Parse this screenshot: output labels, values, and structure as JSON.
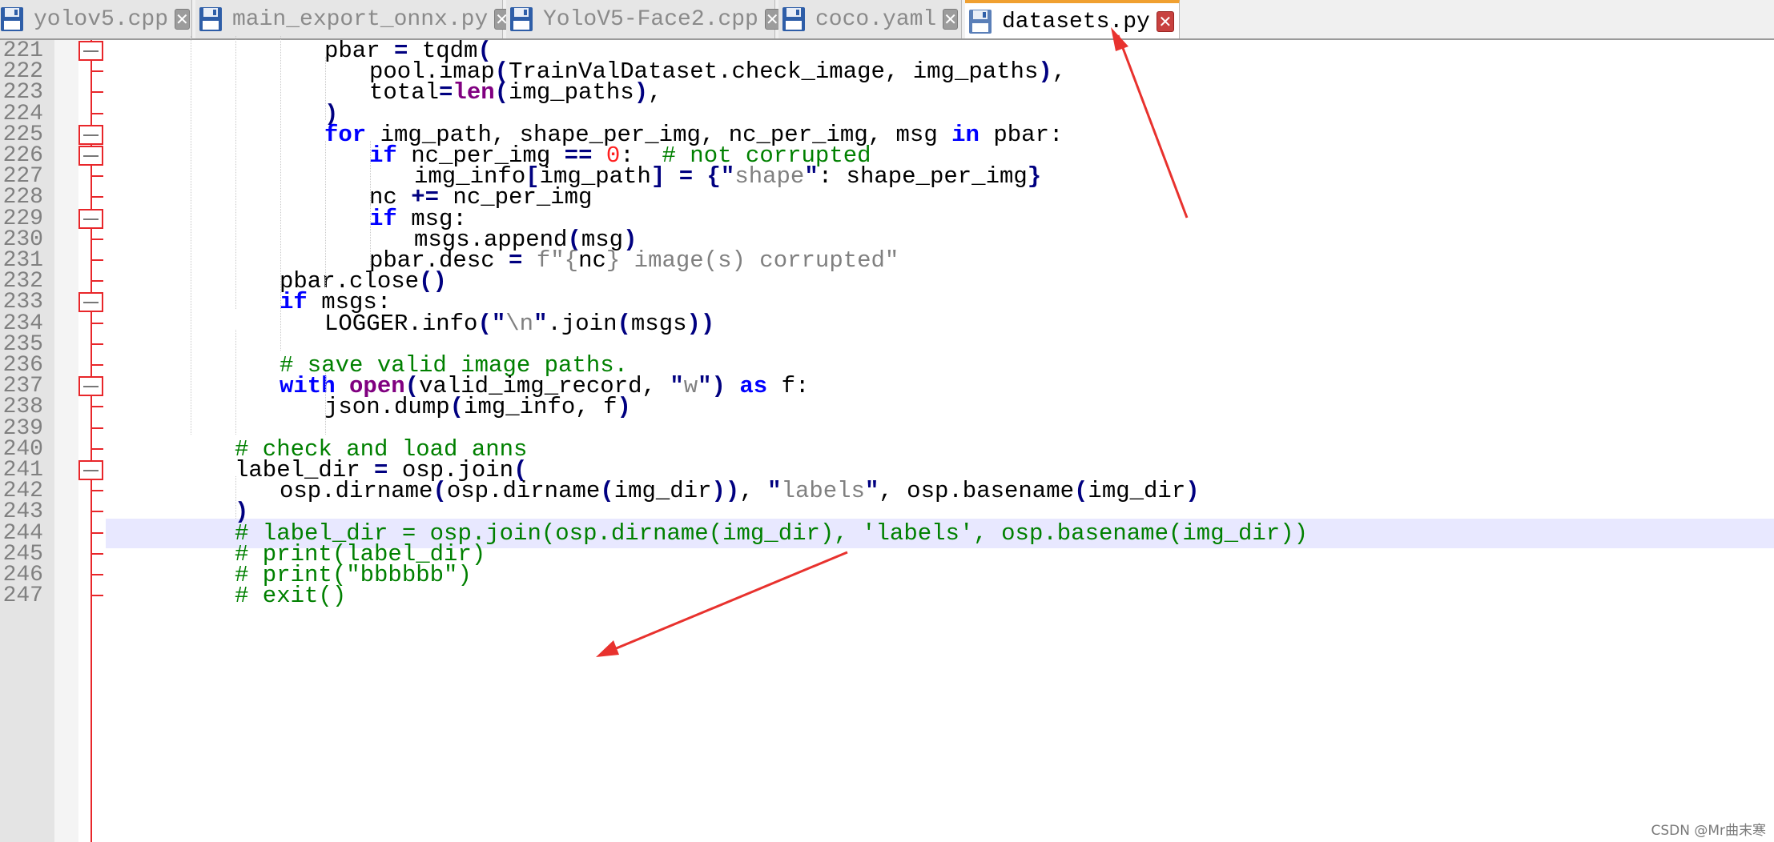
{
  "tabs": [
    {
      "label": "yolov5.cpp",
      "active": false
    },
    {
      "label": "main_export_onnx.py",
      "active": false
    },
    {
      "label": "YoloV5-Face2.cpp",
      "active": false
    },
    {
      "label": "coco.yaml",
      "active": false
    },
    {
      "label": "datasets.py",
      "active": true
    }
  ],
  "tab_close_glyph": "✕",
  "lines": [
    {
      "num": "221",
      "indent": 2,
      "text": "pbar = tqdm("
    },
    {
      "num": "222",
      "indent": 3,
      "text": "pool.imap(TrainValDataset.check_image, img_paths),"
    },
    {
      "num": "223",
      "indent": 3,
      "text": "total=len(img_paths),"
    },
    {
      "num": "224",
      "indent": 2,
      "text": ")"
    },
    {
      "num": "225",
      "indent": 2,
      "text": "for img_path, shape_per_img, nc_per_img, msg in pbar:"
    },
    {
      "num": "226",
      "indent": 3,
      "text": "if nc_per_img == 0:  # not corrupted"
    },
    {
      "num": "227",
      "indent": 4,
      "text": "img_info[img_path] = {\"shape\": shape_per_img}"
    },
    {
      "num": "228",
      "indent": 3,
      "text": "nc += nc_per_img"
    },
    {
      "num": "229",
      "indent": 3,
      "text": "if msg:"
    },
    {
      "num": "230",
      "indent": 4,
      "text": "msgs.append(msg)"
    },
    {
      "num": "231",
      "indent": 3,
      "text": "pbar.desc = f\"{nc} image(s) corrupted\""
    },
    {
      "num": "232",
      "indent": 1,
      "text": "pbar.close()"
    },
    {
      "num": "233",
      "indent": 1,
      "text": "if msgs:"
    },
    {
      "num": "234",
      "indent": 2,
      "text": "LOGGER.info(\"\\n\".join(msgs))"
    },
    {
      "num": "235",
      "indent": 0,
      "text": ""
    },
    {
      "num": "236",
      "indent": 1,
      "text": "# save valid image paths."
    },
    {
      "num": "237",
      "indent": 1,
      "text": "with open(valid_img_record, \"w\") as f:"
    },
    {
      "num": "238",
      "indent": 2,
      "text": "json.dump(img_info, f)"
    },
    {
      "num": "239",
      "indent": 0,
      "text": ""
    },
    {
      "num": "240",
      "indent": 0,
      "text": "# check and load anns"
    },
    {
      "num": "241",
      "indent": 0,
      "text": "label_dir = osp.join("
    },
    {
      "num": "242",
      "indent": 1,
      "text": "osp.dirname(osp.dirname(img_dir)), \"labels\", osp.basename(img_dir)"
    },
    {
      "num": "243",
      "indent": 0,
      "text": ")"
    },
    {
      "num": "244",
      "indent": 0,
      "text": "# label_dir = osp.join(osp.dirname(img_dir), 'labels', osp.basename(img_dir))"
    },
    {
      "num": "245",
      "indent": 0,
      "text": "# print(label_dir)"
    },
    {
      "num": "246",
      "indent": 0,
      "text": "# print(\"bbbbbb\")"
    },
    {
      "num": "247",
      "indent": 0,
      "text": "# exit()"
    }
  ],
  "folded_lines": [
    "221",
    "225",
    "226",
    "229",
    "233",
    "237",
    "241"
  ],
  "current_line": "244",
  "colors": {
    "keyword": "#0000ff",
    "builtin": "#800080",
    "operator": "#000080",
    "number": "#ff2020",
    "string": "#808080",
    "comment": "#008000",
    "fold_marker": "#e8262a",
    "annotation_arrow": "#e8322e",
    "current_line": "#e8e8ff"
  },
  "watermark": "CSDN @Mr曲末寒"
}
